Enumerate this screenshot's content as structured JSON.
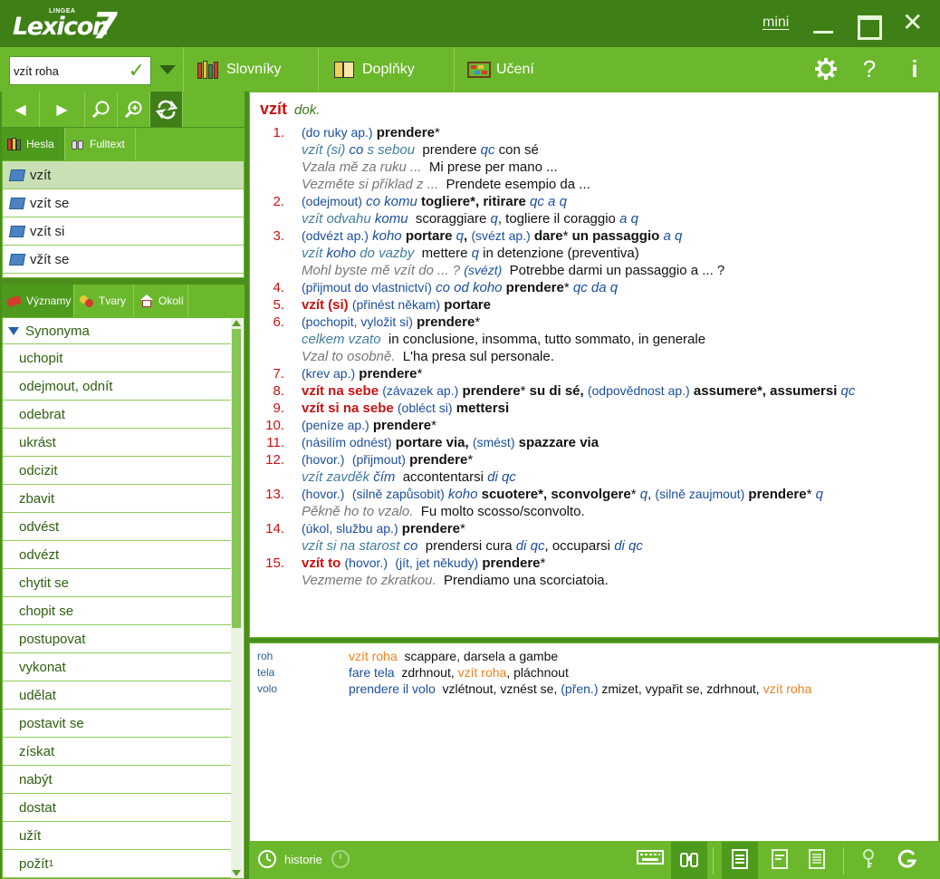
{
  "app": {
    "brand": "Lexicon",
    "version": "7",
    "brand_small": "LINGEA",
    "mini": "mini",
    "close": "✕"
  },
  "search": {
    "value": "vzít roha",
    "ok": "✓"
  },
  "toolbar": {
    "slovniky": "Slovníky",
    "doplnky": "Doplňky",
    "uceni": "Učení",
    "help": "?",
    "info": "i"
  },
  "nav": {
    "back": "◀",
    "forward": "▶"
  },
  "hesla_tabs": {
    "hesla": "Hesla",
    "fulltext": "Fulltext"
  },
  "hesla_list": [
    "vzít",
    "vzít se",
    "vzít si",
    "vžít se"
  ],
  "vyz_tabs": {
    "vyznamy": "Významy",
    "tvary": "Tvary",
    "okoli": "Okolí"
  },
  "synonyma": {
    "header": "Synonyma",
    "items": [
      "uchopit",
      "odejmout, odnít",
      "odebrat",
      "ukrást",
      "odcizit",
      "zbavit",
      "odvést",
      "odvézt",
      "chytit se",
      "chopit se",
      "postupovat",
      "vykonat",
      "udělat",
      "postavit se",
      "získat",
      "nabýt",
      "dostat",
      "užít",
      "požít"
    ],
    "last_sup": "1"
  },
  "entry": {
    "headword": "vzít",
    "gram": "dok.",
    "s1": {
      "n": "1.",
      "a": "(do ruky ap.)",
      "b": "prendere",
      "c": "*"
    },
    "s1e1": {
      "a": "vzít (si)",
      "b": "co",
      "c": "s sebou",
      "d": "prendere",
      "e": "qc",
      "f": "con sé"
    },
    "s1e2": {
      "a": "Vzala mě za ruku ...",
      "b": "Mi prese per mano ..."
    },
    "s1e3": {
      "a": "Vezměte si příklad z ...",
      "b": "Prendete esempio da ..."
    },
    "s2": {
      "n": "2.",
      "a": "(odejmout)",
      "b": "co komu",
      "c": "togliere",
      "d": "*, ",
      "e": "ritirare",
      "f": "qc a q"
    },
    "s2e1": {
      "a": "vzít odvahu",
      "b": "komu",
      "c": "scoraggiare",
      "d": "q",
      "e": ", togliere il coraggio",
      "f": "a q"
    },
    "s3": {
      "n": "3.",
      "a": "(odvézt ap.)",
      "b": "koho",
      "c": "portare",
      "d": "q",
      "e": ",",
      "f": "(svézt ap.)",
      "g": "dare",
      "h": "*",
      "i": "un passaggio",
      "j": "a q"
    },
    "s3e1": {
      "a": "vzít",
      "b": "koho",
      "c": "do vazby",
      "d": "mettere",
      "e": "q",
      "f": "in detenzione (preventiva)"
    },
    "s3e2": {
      "a": "Mohl byste mě vzít do ... ?",
      "b": "(svézt)",
      "c": "Potrebbe darmi un passaggio a ... ?"
    },
    "s4": {
      "n": "4.",
      "a": "(přijmout do vlastnictví)",
      "b": "co od koho",
      "c": "prendere",
      "d": "*",
      "e": "qc da q"
    },
    "s5": {
      "n": "5.",
      "a": "vzít (si)",
      "b": "(přinést někam)",
      "c": "portare"
    },
    "s6": {
      "n": "6.",
      "a": "(pochopit, vyložit si)",
      "b": "prendere",
      "c": "*"
    },
    "s6e1": {
      "a": "celkem vzato",
      "b": "in conclusione, insomma, tutto sommato, in generale"
    },
    "s6e2": {
      "a": "Vzal to osobně.",
      "b": "L'ha presa sul personale."
    },
    "s7": {
      "n": "7.",
      "a": "(krev ap.)",
      "b": "prendere",
      "c": "*"
    },
    "s8": {
      "n": "8.",
      "a": "vzít na sebe",
      "b": "(závazek ap.)",
      "c": "prendere",
      "d": "*",
      "e": "su di sé,",
      "f": "(odpovědnost ap.)",
      "g": "assumere",
      "h": "*, ",
      "i": "assumersi",
      "j": "qc"
    },
    "s9": {
      "n": "9.",
      "a": "vzít si na sebe",
      "b": "(obléct si)",
      "c": "mettersi"
    },
    "s10": {
      "n": "10.",
      "a": "(peníze ap.)",
      "b": "prendere",
      "c": "*"
    },
    "s11": {
      "n": "11.",
      "a": "(násilím odnést)",
      "b": "portare via,",
      "c": "(smést)",
      "d": "spazzare via"
    },
    "s12": {
      "n": "12.",
      "a": "(hovor.)",
      "b": "(přijmout)",
      "c": "prendere",
      "d": "*"
    },
    "s12e1": {
      "a": "vzít zavděk",
      "b": "čím",
      "c": "accontentarsi",
      "d": "di qc"
    },
    "s13": {
      "n": "13.",
      "a": "(hovor.)",
      "b": "(silně zapůsobit)",
      "c": "koho",
      "d": "scuotere",
      "e": "*, ",
      "f": "sconvolgere",
      "g": "*",
      "h": "q",
      "i": ",",
      "j": "(silně zaujmout)",
      "k": "prendere",
      "l": "*",
      "m": "q"
    },
    "s13e1": {
      "a": "Pěkně ho to vzalo.",
      "b": "Fu molto scosso/sconvolto."
    },
    "s14": {
      "n": "14.",
      "a": "(úkol, službu ap.)",
      "b": "prendere",
      "c": "*"
    },
    "s14e1": {
      "a": "vzít si na starost",
      "b": "co",
      "c": "prendersi cura",
      "d": "di qc",
      "e": ", occuparsi",
      "f": "di qc"
    },
    "s15": {
      "n": "15.",
      "a": "vzít to",
      "b": "(hovor.)",
      "c": "(jít, jet někudy)",
      "d": "prendere",
      "e": "*"
    },
    "s15e1": {
      "a": "Vezmeme to zkratkou.",
      "b": "Prendiamo una scorciatoia."
    }
  },
  "phrases": [
    {
      "key": "roh",
      "a": "vzít roha",
      "b": "scappare, darsela a gambe"
    },
    {
      "key": "tela",
      "a": "fare tela",
      "b": "zdrhnout,",
      "c": "vzít roha",
      "d": ", pláchnout"
    },
    {
      "key": "volo",
      "a": "prendere il volo",
      "b": "vzlétnout, vznést se,",
      "c": "(přen.)",
      "d": "zmizet, vypařit se, zdrhnout,",
      "e": "vzít roha"
    }
  ],
  "bottombar": {
    "historie": "historie"
  }
}
